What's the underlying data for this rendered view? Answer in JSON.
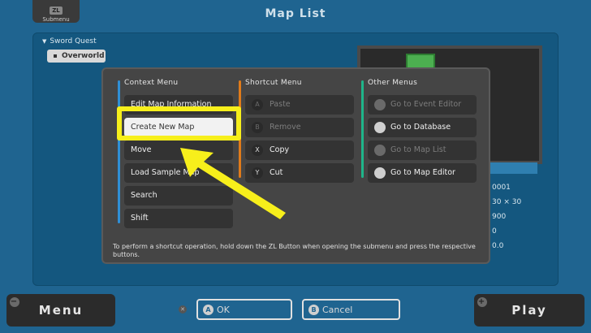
{
  "topbar": {
    "title": "Map List",
    "submenu_key": "ZL",
    "submenu_label": "Submenu"
  },
  "tree": {
    "project": "Sword Quest",
    "map": "Overworld"
  },
  "info": {
    "values": [
      "0001",
      "30 × 30",
      "900",
      "0",
      "0.0"
    ]
  },
  "context_menu": {
    "heading": "Context Menu",
    "accent": "#2f8fd6",
    "items": [
      "Edit Map Information",
      "Create New Map",
      "Move",
      "Load Sample Map",
      "Search",
      "Shift"
    ]
  },
  "shortcut_menu": {
    "heading": "Shortcut Menu",
    "accent": "#e07b1a",
    "items": [
      {
        "key": "A",
        "label": "Paste",
        "enabled": false
      },
      {
        "key": "B",
        "label": "Remove",
        "enabled": false
      },
      {
        "key": "X",
        "label": "Copy",
        "enabled": true
      },
      {
        "key": "Y",
        "label": "Cut",
        "enabled": true
      }
    ]
  },
  "other_menus": {
    "heading": "Other Menus",
    "accent": "#1fb58a",
    "items": [
      {
        "icon": "event-editor-icon",
        "label": "Go to Event Editor",
        "enabled": false
      },
      {
        "icon": "database-icon",
        "label": "Go to Database",
        "enabled": true
      },
      {
        "icon": "map-list-icon",
        "label": "Go to Map List",
        "enabled": false
      },
      {
        "icon": "map-editor-icon",
        "label": "Go to Map Editor",
        "enabled": true
      }
    ]
  },
  "hint": "To perform a shortcut operation, hold down the ZL Button when opening the submenu and press the respective buttons.",
  "bottom": {
    "menu_label": "Menu",
    "play_label": "Play",
    "ok_key": "A",
    "ok_label": "OK",
    "cancel_key": "B",
    "cancel_label": "Cancel"
  },
  "annotation_color": "#f7ef1b"
}
